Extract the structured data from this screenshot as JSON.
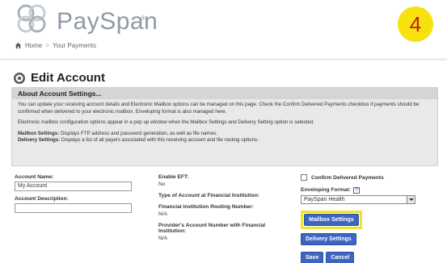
{
  "brand": {
    "name": "PaySpan",
    "reg": "®"
  },
  "step": "4",
  "breadcrumb": {
    "home": "Home",
    "sep": ">",
    "current": "Your Payments"
  },
  "page": {
    "title": "Edit Account"
  },
  "info": {
    "heading": "About Account Settings...",
    "p1": "You can update your receiving account details and Electronic Mailbox options can be managed on this page. Check the Confirm Delivered Payments checkbox if payments should be confirmed when delivered to your electronic mailbox. Enveloping format is also managed here.",
    "p2": "Electronic mailbox configuration options appear in a pop up window when the Mailbox Settings and Delivery Setting option is selected.",
    "mailbox_label": "Mailbox Settings:",
    "mailbox_text": "Displays FTP address and password generation, as well as file names.",
    "delivery_label": "Delivery Settings:",
    "delivery_text": "Displays a list of all payers associated with this receiving account and file routing options."
  },
  "form": {
    "account_name_label": "Account Name:",
    "account_name_value": "My Account",
    "account_desc_label": "Account Description:",
    "account_desc_value": "",
    "eft_label": "Enable EFT:",
    "eft_value": "No",
    "type_label": "Type of Account at Financial Institution:",
    "routing_label": "Financial Institution Routing Number:",
    "routing_value": "N/A",
    "acct_num_label": "Provider's Account Number with Financial Institution:",
    "acct_num_value": "N/A",
    "confirm_label": "Confirm Delivered Payments",
    "enveloping_label": "Enveloping Format:",
    "help": "?",
    "enveloping_value": "PaySpan Health"
  },
  "buttons": {
    "mailbox": "Mailbox Settings",
    "delivery": "Delivery Settings",
    "save": "Save",
    "cancel": "Cancel"
  },
  "colors": {
    "accent": "#3e66c1",
    "highlight": "#f0e22a",
    "badge": "#f7e20f"
  }
}
